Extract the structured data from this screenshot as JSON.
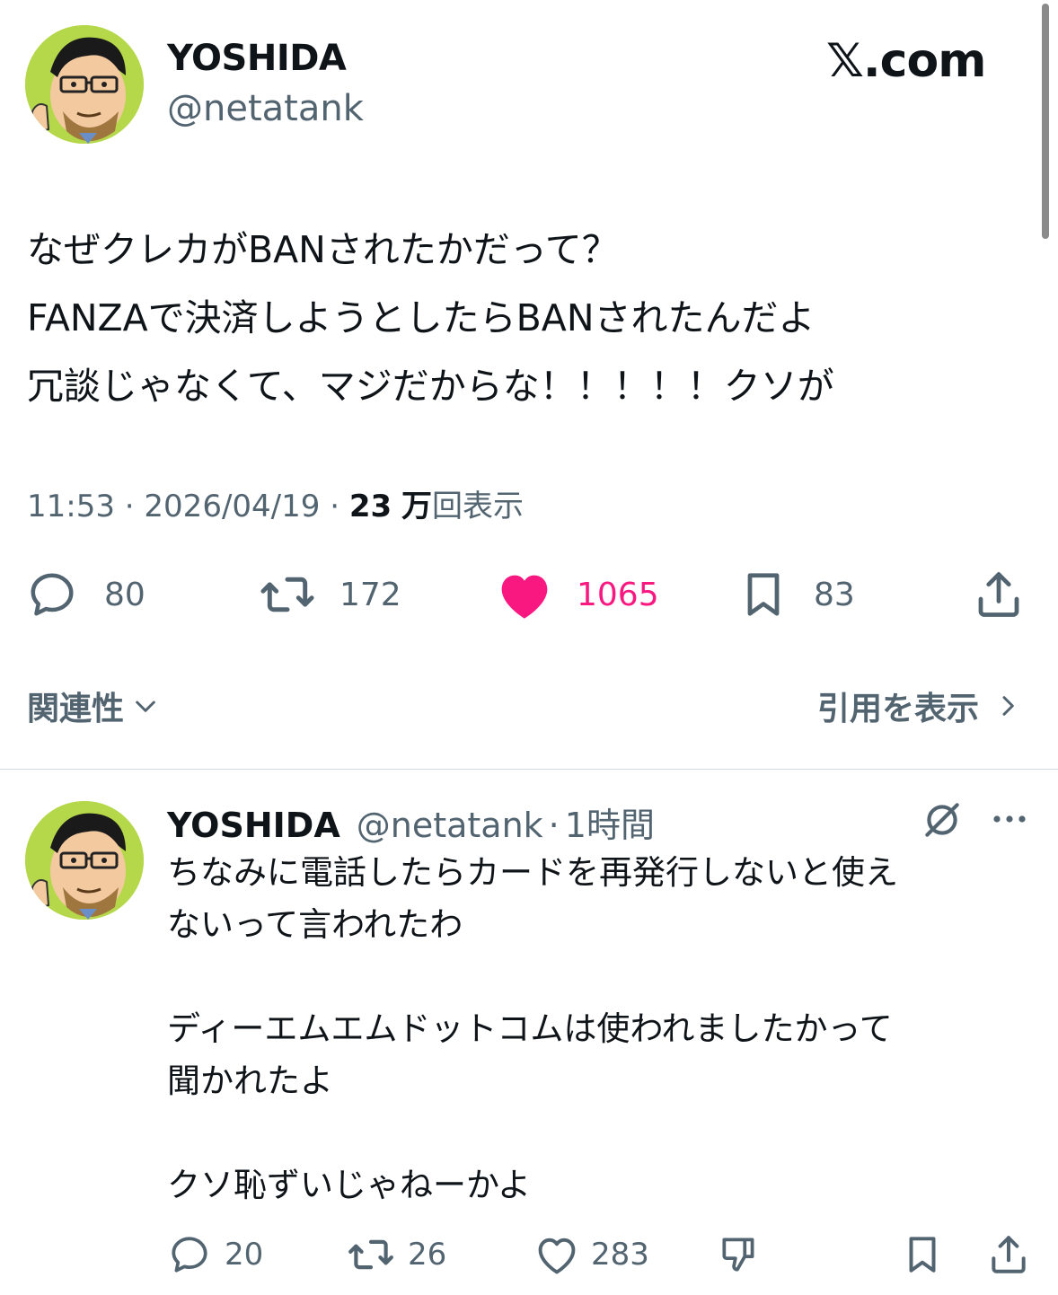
{
  "brand": "𝕏.com",
  "tweet": {
    "author_name": "YOSHIDA",
    "author_handle": "@netatank",
    "text_lines": [
      "なぜクレカがBANされたかだって？",
      "FANZAで決済しようとしたらBANされたんだよ",
      "冗談じゃなくて、マジだからな！！！！！クソが"
    ],
    "time": "11:53",
    "date": "2026/04/19",
    "views_count": "23",
    "views_unit": "万",
    "views_label": "回表示",
    "replies": "80",
    "reposts": "172",
    "likes": "1065",
    "bookmarks": "83",
    "like_color": "#f91880"
  },
  "links": {
    "relevance": "関連性",
    "view_quotes": "引用を表示"
  },
  "reply": {
    "author_name": "YOSHIDA",
    "author_handle": "@netatank",
    "time_ago": "1時間",
    "text_lines": [
      "ちなみに電話したらカードを再発行しないと使え",
      "ないって言われたわ",
      "",
      "ディーエムエムドットコムは使われましたかって",
      "聞かれたよ",
      "",
      "クソ恥ずいじゃねーかよ"
    ],
    "replies": "20",
    "reposts": "26",
    "likes": "283"
  }
}
